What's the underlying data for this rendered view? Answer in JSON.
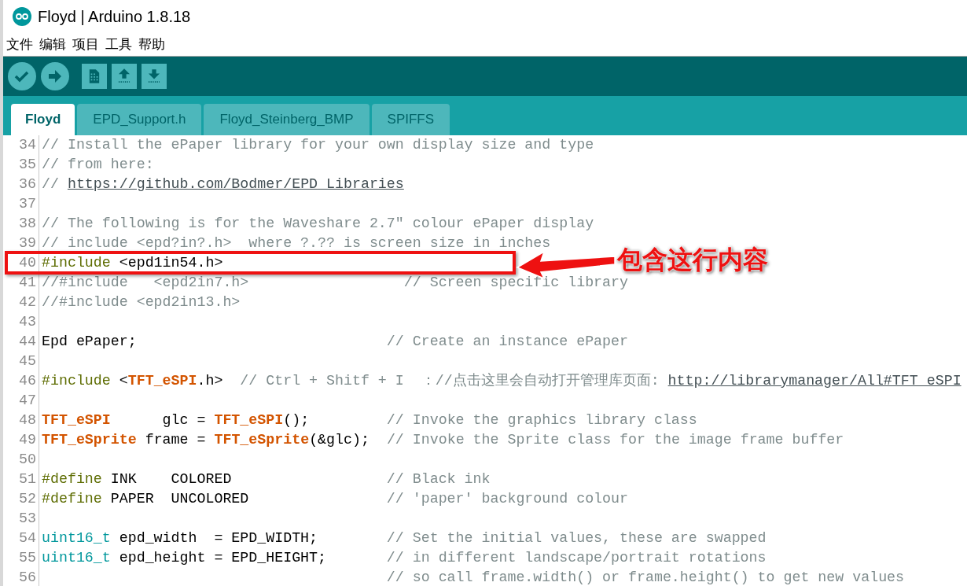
{
  "window": {
    "title": "Floyd | Arduino 1.8.18"
  },
  "menu": [
    "文件",
    "编辑",
    "项目",
    "工具",
    "帮助"
  ],
  "toolbar": [
    {
      "kind": "verify"
    },
    {
      "kind": "upload"
    },
    {
      "kind": "new"
    },
    {
      "kind": "open"
    },
    {
      "kind": "save"
    }
  ],
  "tabs": [
    {
      "label": "Floyd",
      "selected": true
    },
    {
      "label": "EPD_Support.h",
      "selected": false
    },
    {
      "label": "Floyd_Steinberg_BMP",
      "selected": false
    },
    {
      "label": "SPIFFS",
      "selected": false
    }
  ],
  "editor": {
    "lines": [
      {
        "number": "34",
        "tokens": [
          {
            "kind": "comment",
            "text": "// Install the ePaper library for your own display size and type"
          }
        ]
      },
      {
        "number": "35",
        "tokens": [
          {
            "kind": "comment",
            "text": "// from here:"
          }
        ]
      },
      {
        "number": "36",
        "tokens": [
          {
            "kind": "comment",
            "text": "// "
          },
          {
            "kind": "link",
            "text": "https://github.com/Bodmer/EPD_Libraries"
          }
        ]
      },
      {
        "number": "37"
      },
      {
        "number": "38",
        "tokens": [
          {
            "kind": "comment",
            "text": "// The following is for the Waveshare 2.7\" colour ePaper display"
          }
        ]
      },
      {
        "number": "39",
        "tokens": [
          {
            "kind": "comment",
            "text": "// include <epd?in?.h>  where ?.?? is screen size in inches"
          }
        ]
      },
      {
        "number": "40",
        "tokens": [
          {
            "kind": "directive",
            "text": "#include"
          },
          {
            "kind": "plain",
            "text": " <epd1in54.h>"
          }
        ]
      },
      {
        "number": "41",
        "tokens": [
          {
            "kind": "comment",
            "text": "//#include   <epd2in7.h>                  // Screen specific library"
          }
        ]
      },
      {
        "number": "42",
        "tokens": [
          {
            "kind": "comment",
            "text": "//#include <epd2in13.h>"
          }
        ]
      },
      {
        "number": "43"
      },
      {
        "number": "44",
        "tokens": [
          {
            "kind": "plain",
            "text": "Epd ePaper;                             "
          },
          {
            "kind": "comment",
            "text": "// Create an instance ePaper"
          }
        ]
      },
      {
        "number": "45"
      },
      {
        "number": "46",
        "tokens": [
          {
            "kind": "directive",
            "text": "#include"
          },
          {
            "kind": "plain",
            "text": " <"
          },
          {
            "kind": "lib",
            "text": "TFT_eSPI"
          },
          {
            "kind": "plain",
            "text": ".h>  "
          },
          {
            "kind": "comment",
            "text": "// Ctrl + Shitf + I  ：//点击这里会自动打开管理库页面: "
          },
          {
            "kind": "link",
            "text": "http://librarymanager/All#TFT_eSPI"
          }
        ]
      },
      {
        "number": "47"
      },
      {
        "number": "48",
        "tokens": [
          {
            "kind": "lib",
            "text": "TFT_eSPI"
          },
          {
            "kind": "plain",
            "text": "      glc = "
          },
          {
            "kind": "lib",
            "text": "TFT_eSPI"
          },
          {
            "kind": "plain",
            "text": "();         "
          },
          {
            "kind": "comment",
            "text": "// Invoke the graphics library class"
          }
        ]
      },
      {
        "number": "49",
        "tokens": [
          {
            "kind": "lib",
            "text": "TFT_eSprite"
          },
          {
            "kind": "plain",
            "text": " frame = "
          },
          {
            "kind": "lib",
            "text": "TFT_eSprite"
          },
          {
            "kind": "plain",
            "text": "(&glc);  "
          },
          {
            "kind": "comment",
            "text": "// Invoke the Sprite class for the image frame buffer"
          }
        ]
      },
      {
        "number": "50"
      },
      {
        "number": "51",
        "tokens": [
          {
            "kind": "directive",
            "text": "#define"
          },
          {
            "kind": "plain",
            "text": " INK    COLORED                  "
          },
          {
            "kind": "comment",
            "text": "// Black ink"
          }
        ]
      },
      {
        "number": "52",
        "tokens": [
          {
            "kind": "directive",
            "text": "#define"
          },
          {
            "kind": "plain",
            "text": " PAPER  UNCOLORED                "
          },
          {
            "kind": "comment",
            "text": "// 'paper' background colour"
          }
        ]
      },
      {
        "number": "53"
      },
      {
        "number": "54",
        "tokens": [
          {
            "kind": "type",
            "text": "uint16_t"
          },
          {
            "kind": "plain",
            "text": " epd_width  = EPD_WIDTH;        "
          },
          {
            "kind": "comment",
            "text": "// Set the initial values, these are swapped"
          }
        ]
      },
      {
        "number": "55",
        "tokens": [
          {
            "kind": "type",
            "text": "uint16_t"
          },
          {
            "kind": "plain",
            "text": " epd_height = EPD_HEIGHT;       "
          },
          {
            "kind": "comment",
            "text": "// in different landscape/portrait rotations"
          }
        ]
      },
      {
        "number": "56",
        "tokens": [
          {
            "kind": "comment",
            "text": "                                        // so call frame.width() or frame.height() to get new values"
          }
        ]
      }
    ]
  },
  "annotation": {
    "label": "包含这行内容"
  }
}
